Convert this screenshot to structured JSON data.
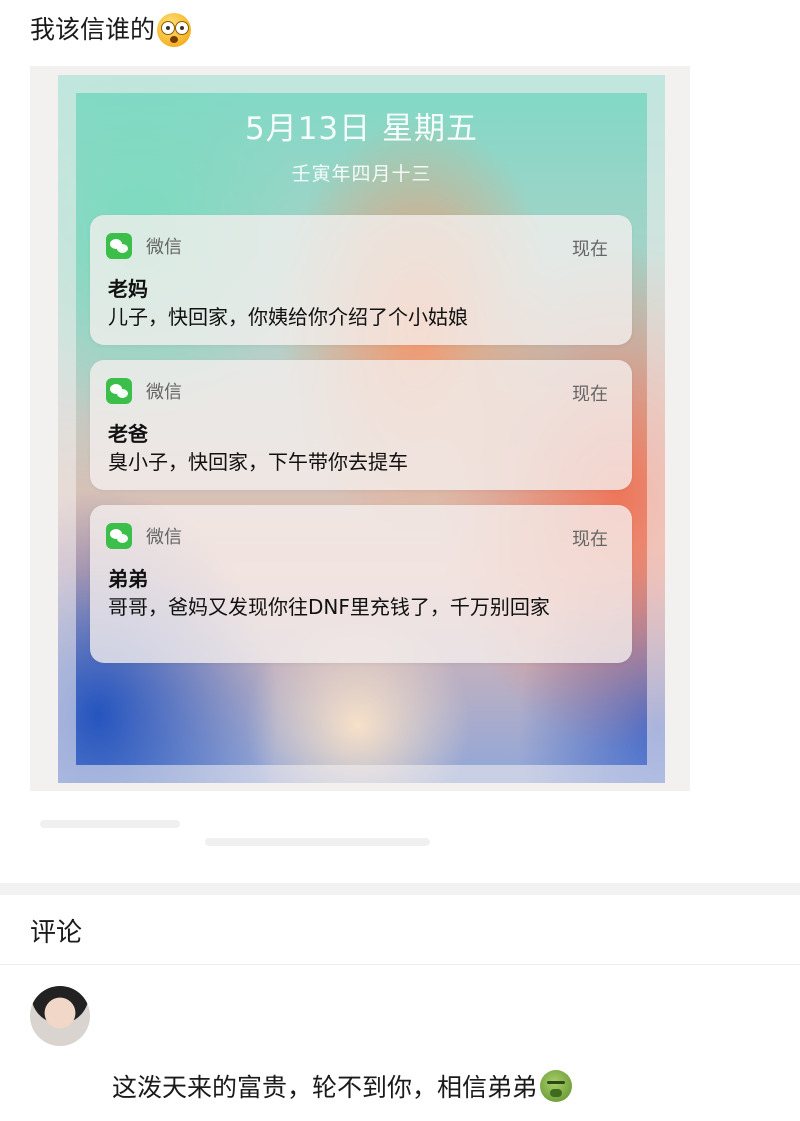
{
  "post": {
    "text": "我该信谁的",
    "emoji": "flushed-face-emoji"
  },
  "screenshot": {
    "date": "5月13日 星期五",
    "lunar_date": "壬寅年四月十三",
    "notifications": [
      {
        "app": "微信",
        "time": "现在",
        "title": "老妈",
        "body": "儿子，快回家，你姨给你介绍了个小姑娘",
        "icon": "wechat-icon"
      },
      {
        "app": "微信",
        "time": "现在",
        "title": "老爸",
        "body": "臭小子，快回家，下午带你去提车",
        "icon": "wechat-icon"
      },
      {
        "app": "微信",
        "time": "现在",
        "title": "弟弟",
        "body": "哥哥，爸妈又发现你往DNF里充钱了，千万别回家",
        "icon": "wechat-icon"
      }
    ]
  },
  "comments": {
    "heading": "评论",
    "items": [
      {
        "text": "这泼天来的富贵，轮不到你，相信弟弟",
        "emoji": "nauseated-face-emoji"
      }
    ]
  },
  "colors": {
    "wechat_green": "#3bbf4a",
    "text": "#1a1a1a",
    "divider": "#f2f2f2"
  }
}
